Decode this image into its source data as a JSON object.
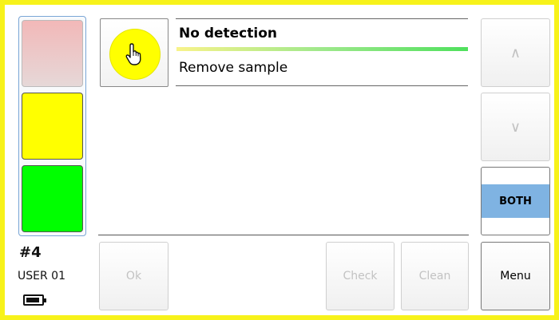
{
  "status": {
    "indicator_number": "#4",
    "user_label": "USER 01",
    "battery_icon": "battery-icon"
  },
  "traffic_light": {
    "red": "#f2b8b8",
    "yellow": "#ffff00",
    "green": "#00ff00",
    "active": [
      "yellow",
      "green"
    ]
  },
  "message": {
    "icon": "hand-pointer-icon",
    "title": "No detection",
    "subtitle": "Remove sample"
  },
  "buttons": {
    "ok": "Ok",
    "check": "Check",
    "clean": "Clean",
    "up": "∧",
    "down": "∨",
    "both": "BOTH",
    "menu": "Menu"
  },
  "colors": {
    "frame": "#f7f21a",
    "selected": "#7fb3e2"
  }
}
